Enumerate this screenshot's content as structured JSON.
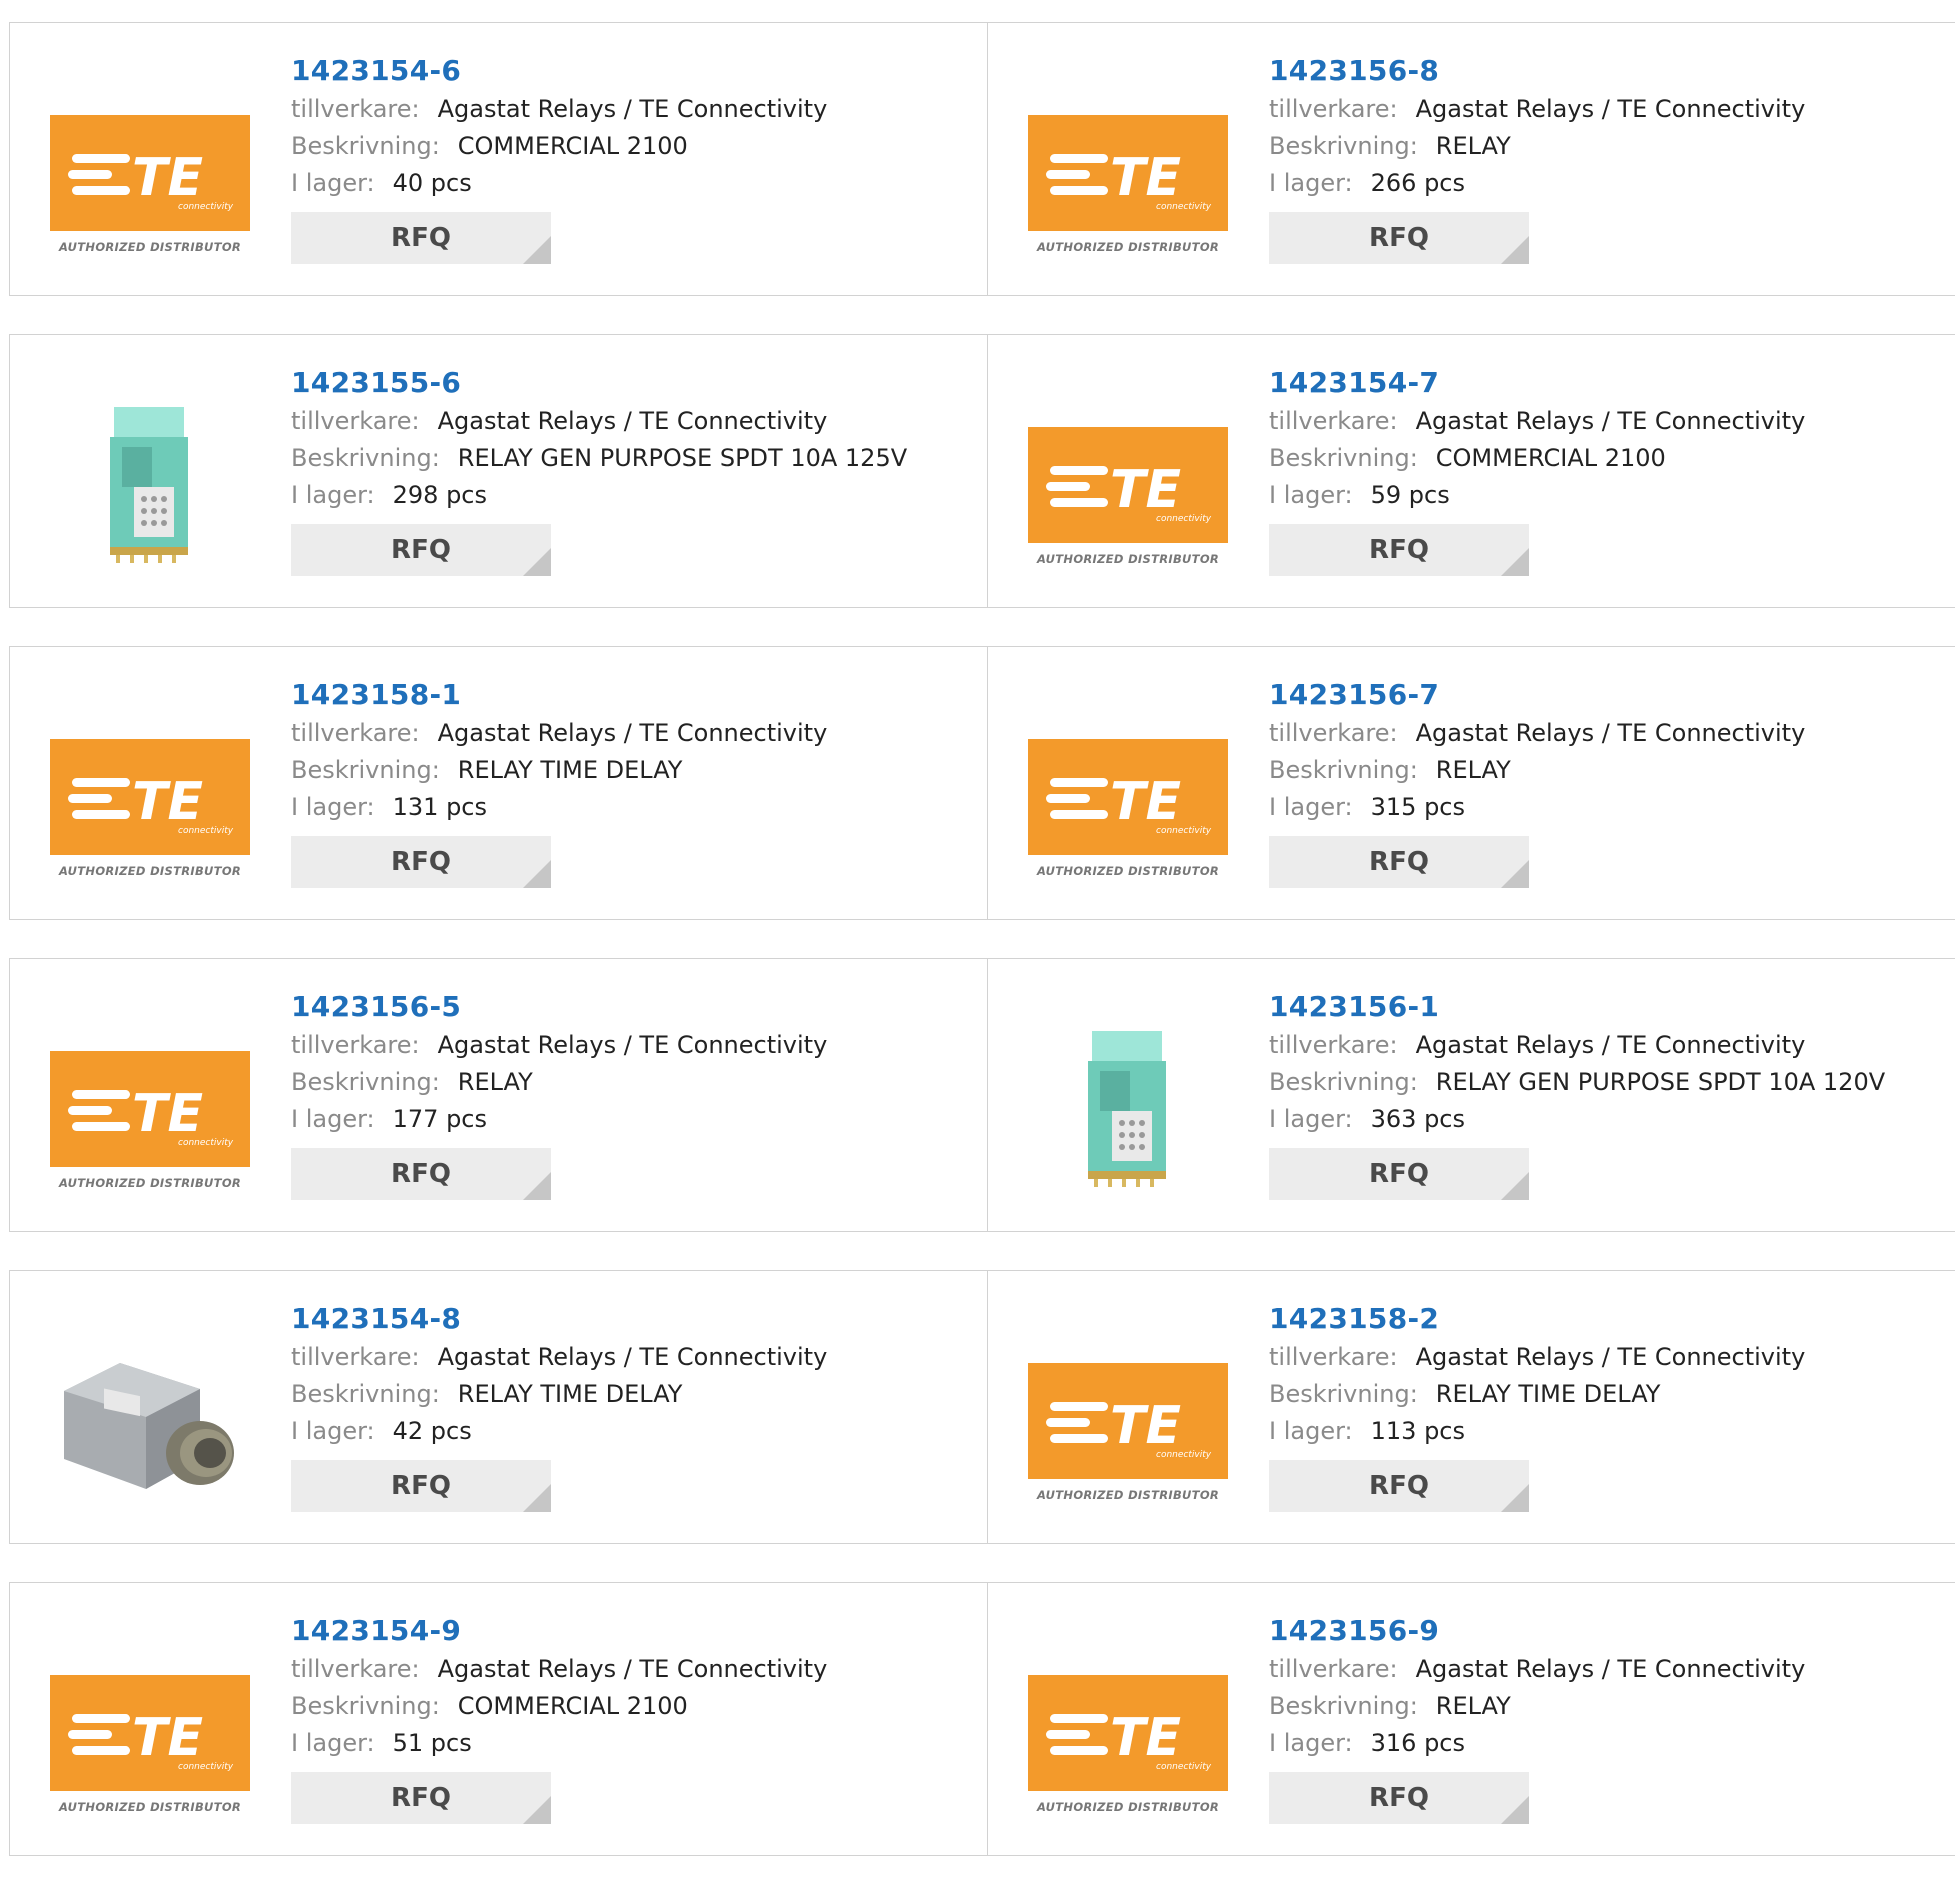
{
  "labels": {
    "manufacturer": "tillverkare:",
    "description": "Beskrivning:",
    "stock": "I lager:",
    "rfq": "RFQ"
  },
  "logo": {
    "brand": "TE",
    "sub": "connectivity",
    "caption": "AUTHORIZED DISTRIBUTOR"
  },
  "colors": {
    "brand_orange": "#f39a2b",
    "link_blue": "#1f6fba",
    "relay_teal": "#7fd6c6"
  },
  "products": [
    {
      "part": "1423154-6",
      "manufacturer": "Agastat Relays / TE Connectivity",
      "description": "COMMERCIAL 2100",
      "stock": "40 pcs",
      "image": "te-logo"
    },
    {
      "part": "1423156-8",
      "manufacturer": "Agastat Relays / TE Connectivity",
      "description": "RELAY",
      "stock": "266 pcs",
      "image": "te-logo"
    },
    {
      "part": "1423155-6",
      "manufacturer": "Agastat Relays / TE Connectivity",
      "description": "RELAY GEN PURPOSE SPDT 10A 125V",
      "stock": "298 pcs",
      "image": "relay-photo"
    },
    {
      "part": "1423154-7",
      "manufacturer": "Agastat Relays / TE Connectivity",
      "description": "COMMERCIAL 2100",
      "stock": "59 pcs",
      "image": "te-logo"
    },
    {
      "part": "1423158-1",
      "manufacturer": "Agastat Relays / TE Connectivity",
      "description": "RELAY TIME DELAY",
      "stock": "131 pcs",
      "image": "te-logo"
    },
    {
      "part": "1423156-7",
      "manufacturer": "Agastat Relays / TE Connectivity",
      "description": "RELAY",
      "stock": "315 pcs",
      "image": "te-logo"
    },
    {
      "part": "1423156-5",
      "manufacturer": "Agastat Relays / TE Connectivity",
      "description": "RELAY",
      "stock": "177 pcs",
      "image": "te-logo"
    },
    {
      "part": "1423156-1",
      "manufacturer": "Agastat Relays / TE Connectivity",
      "description": "RELAY GEN PURPOSE SPDT 10A 120V",
      "stock": "363 pcs",
      "image": "relay-photo"
    },
    {
      "part": "1423154-8",
      "manufacturer": "Agastat Relays / TE Connectivity",
      "description": "RELAY TIME DELAY",
      "stock": "42 pcs",
      "image": "timer-relay-photo"
    },
    {
      "part": "1423158-2",
      "manufacturer": "Agastat Relays / TE Connectivity",
      "description": "RELAY TIME DELAY",
      "stock": "113 pcs",
      "image": "te-logo"
    },
    {
      "part": "1423154-9",
      "manufacturer": "Agastat Relays / TE Connectivity",
      "description": "COMMERCIAL 2100",
      "stock": "51 pcs",
      "image": "te-logo"
    },
    {
      "part": "1423156-9",
      "manufacturer": "Agastat Relays / TE Connectivity",
      "description": "RELAY",
      "stock": "316 pcs",
      "image": "te-logo"
    }
  ]
}
